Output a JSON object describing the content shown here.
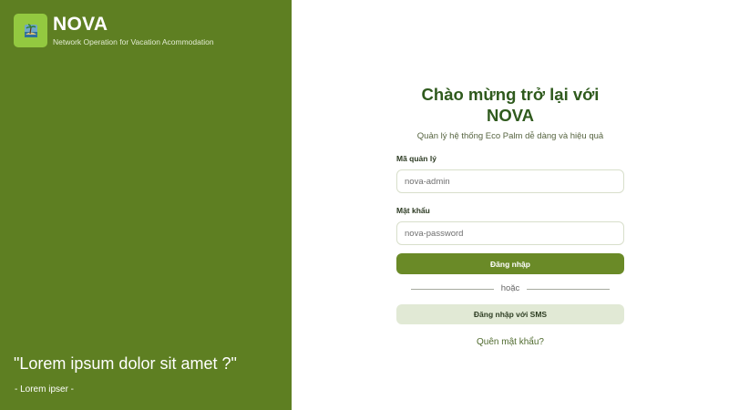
{
  "brand": {
    "name": "NOVA",
    "tagline": "Network Operation for Vacation Acommodation",
    "logo_icon": "palm-island-icon"
  },
  "quote": {
    "text": "\"Lorem ipsum dolor sit amet ?\"",
    "author": "- Lorem ipser -"
  },
  "login": {
    "title": "Chào mừng trở lại với NOVA",
    "subtitle": "Quản lý hệ thống Eco Palm dễ dàng và hiệu quả",
    "username_label": "Mã quản lý",
    "username_placeholder": "nova-admin",
    "password_label": "Mật khẩu",
    "password_placeholder": "nova-password",
    "submit_label": "Đăng nhập",
    "divider_text": "hoặc",
    "sms_label": "Đăng nhập với SMS",
    "forgot_label": "Quên mật khẩu?"
  },
  "colors": {
    "panel": "#5e7f22",
    "primary_button": "#6a8a27",
    "secondary_button": "#e1e9d5",
    "title": "#2f5a1d"
  }
}
